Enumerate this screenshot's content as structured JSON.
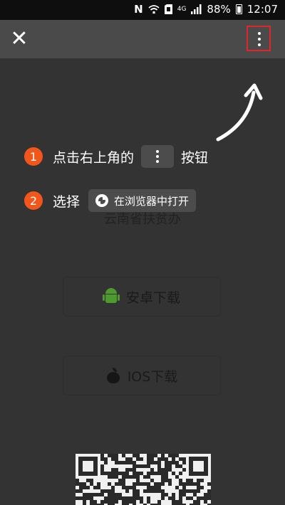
{
  "status_bar": {
    "n_glyph": "N",
    "network": "4G",
    "battery_percent": "88%",
    "time": "12:07"
  },
  "navbar": {
    "close_symbol": "✕"
  },
  "guide": {
    "step1_number": "1",
    "step1_text_before": "点击右上角的",
    "step1_text_after": "按钮",
    "step2_number": "2",
    "step2_text": "选择",
    "step2_button_label": "在浏览器中打开"
  },
  "page": {
    "org_name": "云南省扶贫办",
    "android_download_label": "安卓下载",
    "ios_download_label": "IOS下载"
  },
  "colors": {
    "accent_orange": "#f1571b",
    "highlight_red": "#e0252b",
    "overlay_bg": "#333333"
  }
}
